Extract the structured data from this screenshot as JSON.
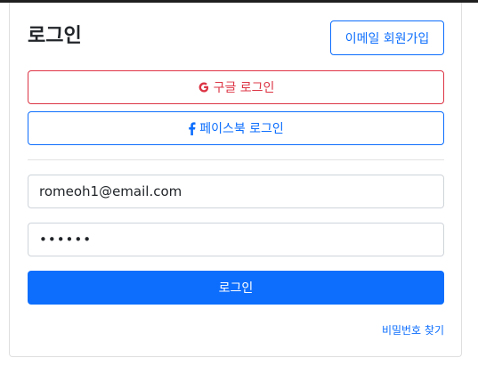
{
  "header": {
    "title": "로그인",
    "signup_label": "이메일 회원가입"
  },
  "social": {
    "google_label": "구글 로그인",
    "facebook_label": "페이스북 로그인"
  },
  "form": {
    "email_value": "romeoh1@email.com",
    "password_value": "••••••",
    "submit_label": "로그인",
    "forgot_label": "비밀번호 찾기"
  },
  "icons": {
    "google": "google-icon",
    "facebook": "facebook-icon"
  },
  "colors": {
    "primary": "#0d6efd",
    "danger": "#dc3545"
  }
}
